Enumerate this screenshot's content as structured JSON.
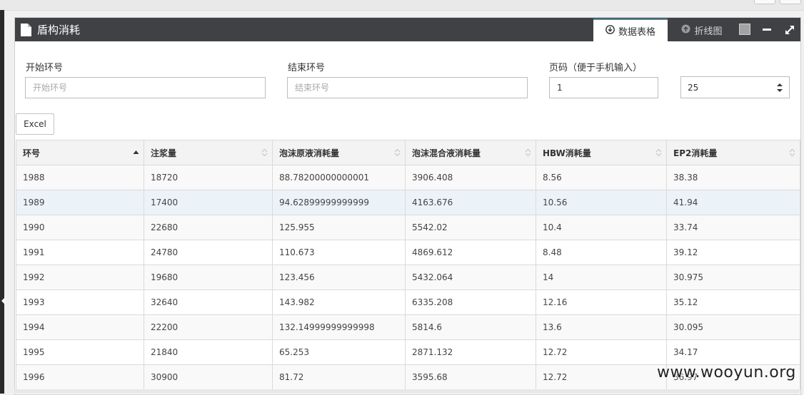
{
  "panel": {
    "title": "盾构消耗"
  },
  "tabs": {
    "table": "数据表格",
    "chart": "折线图"
  },
  "filters": {
    "start_ring": {
      "label": "开始环号",
      "placeholder": "开始环号",
      "value": ""
    },
    "end_ring": {
      "label": "结束环号",
      "placeholder": "结束环号",
      "value": ""
    },
    "page": {
      "label": "页码（便于手机输入）",
      "value": "1"
    },
    "page_size": {
      "value": "25"
    }
  },
  "toolbar": {
    "excel_label": "Excel"
  },
  "table": {
    "headers": [
      "环号",
      "注浆量",
      "泡沫原液消耗量",
      "泡沫混合液消耗量",
      "HBW消耗量",
      "EP2消耗量"
    ],
    "rows": [
      [
        "1988",
        "18720",
        "88.78200000000001",
        "3906.408",
        "8.56",
        "38.38"
      ],
      [
        "1989",
        "17400",
        "94.62899999999999",
        "4163.676",
        "10.56",
        "41.94"
      ],
      [
        "1990",
        "22680",
        "125.955",
        "5542.02",
        "10.4",
        "33.74"
      ],
      [
        "1991",
        "24780",
        "110.673",
        "4869.612",
        "8.48",
        "39.12"
      ],
      [
        "1992",
        "19680",
        "123.456",
        "5432.064",
        "14",
        "30.975"
      ],
      [
        "1993",
        "32640",
        "143.982",
        "6335.208",
        "12.16",
        "35.12"
      ],
      [
        "1994",
        "22200",
        "132.14999999999998",
        "5814.6",
        "13.6",
        "30.095"
      ],
      [
        "1995",
        "21840",
        "65.253",
        "2871.132",
        "12.72",
        "34.17"
      ],
      [
        "1996",
        "30900",
        "81.72",
        "3595.68",
        "12.72",
        "36.97"
      ]
    ]
  },
  "watermark": "www.wooyun.org",
  "colors": {
    "header_bg": "#404145",
    "row_highlight": "#ecf3f8",
    "tab_accent": "#57889c"
  }
}
